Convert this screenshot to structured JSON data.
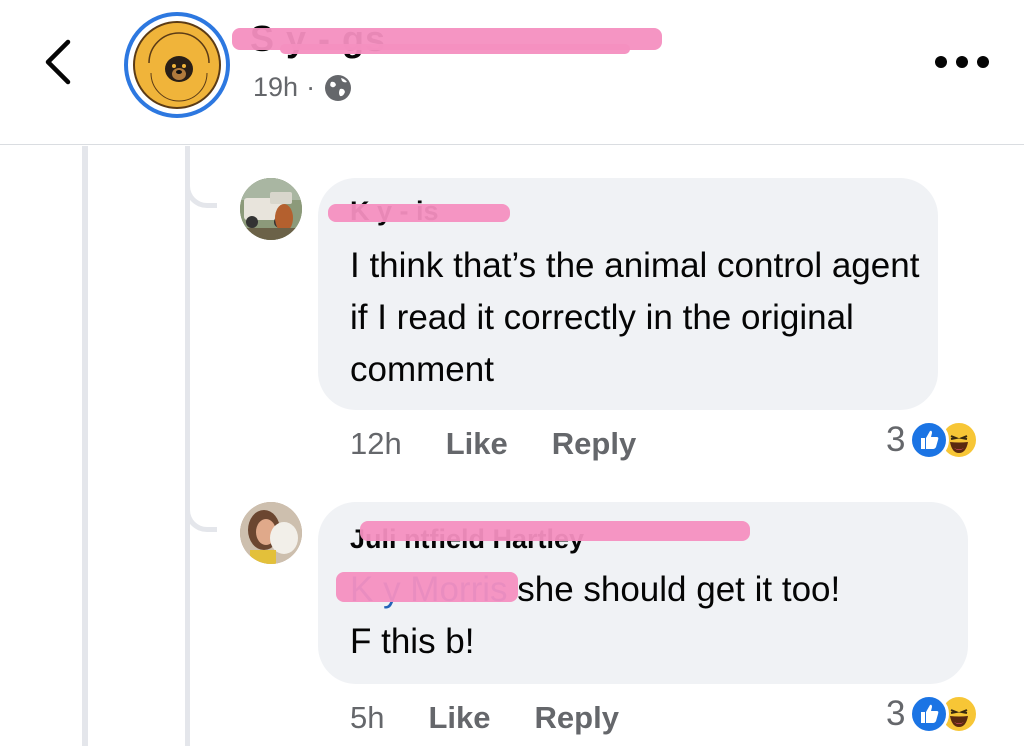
{
  "post": {
    "page_name": "S   y        -       gs",
    "time": "19h",
    "separator": "·",
    "audience_icon": "globe-icon"
  },
  "comments": [
    {
      "author": "K     y      -       is",
      "text": "I think that’s the animal control agent if I read it correctly in the original comment",
      "time": "12h",
      "like": "Like",
      "reply": "Reply",
      "reaction_count": "3",
      "reactions": [
        "like-icon",
        "haha-icon"
      ]
    },
    {
      "author": "Juli        ntfield  Hartley",
      "mention": "K     y   Morris",
      "text": " she should get it too!",
      "text2": "F this b!",
      "time": "5h",
      "like": "Like",
      "reply": "Reply",
      "reaction_count": "3",
      "reactions": [
        "like-icon",
        "haha-icon"
      ]
    }
  ],
  "colors": {
    "bubble": "#f0f2f5",
    "mention": "#2364b8",
    "redaction": "#f48fc0",
    "like": "#1b74e4",
    "haha": "#f7c636"
  }
}
